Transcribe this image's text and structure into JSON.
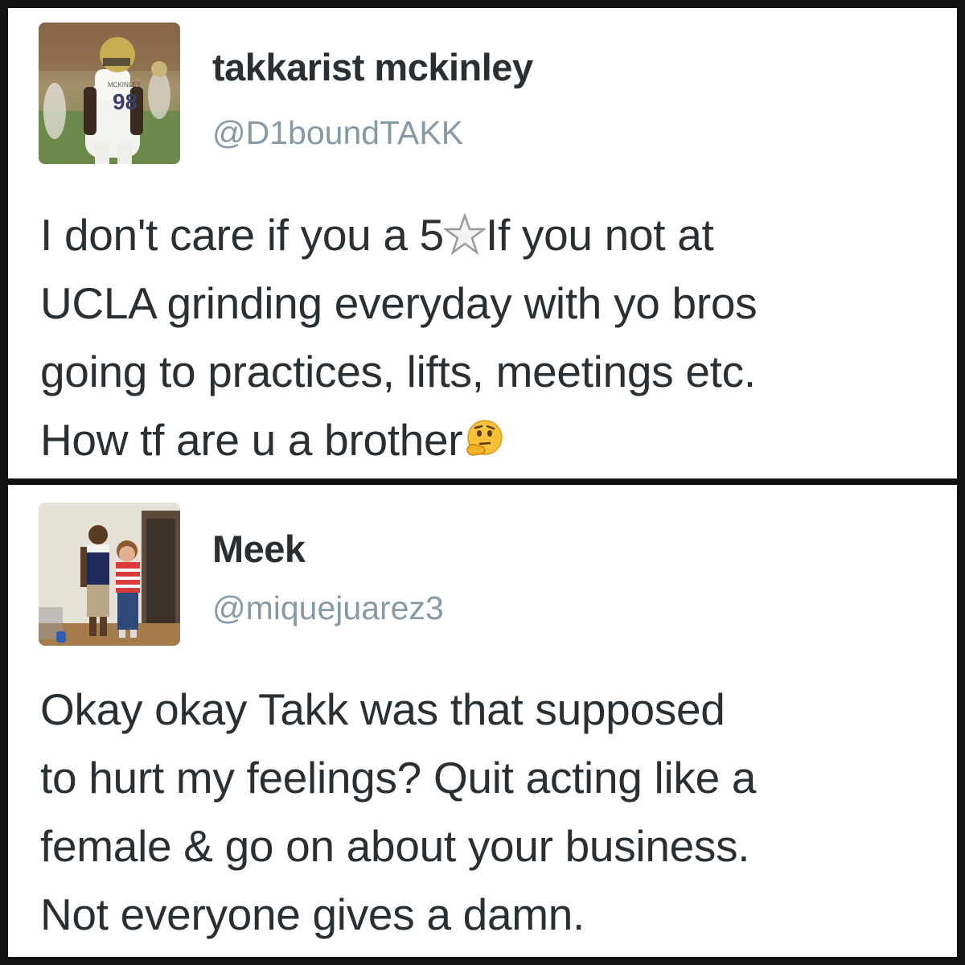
{
  "tweets": [
    {
      "display_name": "takkarist mckinley",
      "handle": "@D1boundTAKK",
      "avatar": "football-player-photo",
      "body_lines": [
        [
          "I don't care if you a 5",
          "star-emoji",
          "If you not at"
        ],
        [
          "UCLA grinding everyday with yo bros"
        ],
        [
          "going to practices, lifts, meetings etc."
        ],
        [
          "How tf are u a brother",
          "thinking-face-emoji"
        ]
      ],
      "avatar_jersey_number": "98",
      "avatar_jersey_name": "MCKINLEY"
    },
    {
      "display_name": "Meek",
      "handle": "@miquejuarez3",
      "avatar": "two-people-photo",
      "body_lines": [
        [
          "Okay okay Takk was that supposed"
        ],
        [
          "to hurt my feelings? Quit acting like a"
        ],
        [
          "female & go on about your business."
        ],
        [
          "Not everyone gives a damn."
        ]
      ]
    }
  ],
  "colors": {
    "name": "#292f33",
    "handle": "#8899a6",
    "body": "#292f33",
    "frame": "#111111",
    "card": "#ffffff"
  }
}
